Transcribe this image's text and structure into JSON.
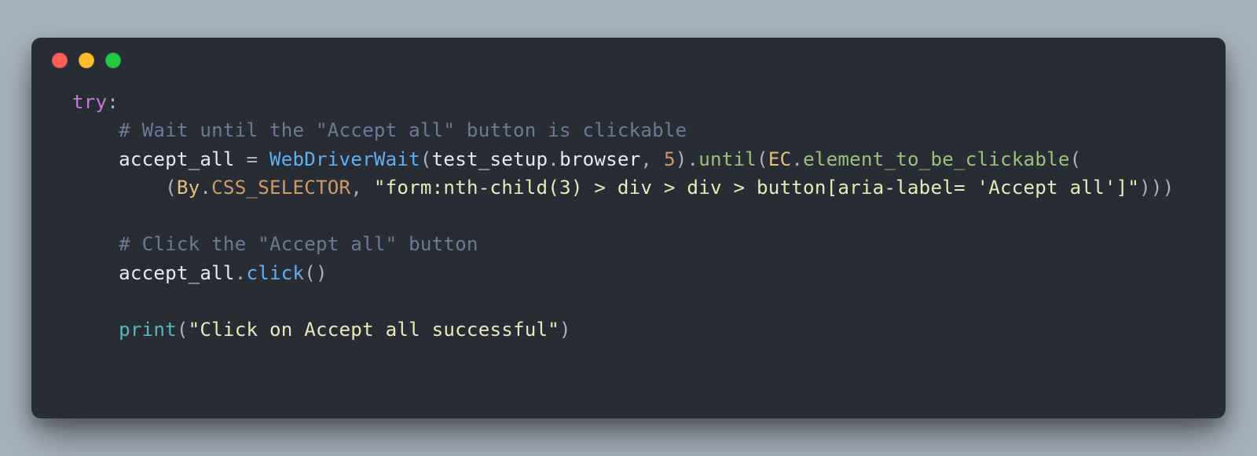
{
  "window": {
    "dots": [
      "red",
      "yellow",
      "green"
    ]
  },
  "code": {
    "tokens": [
      [
        {
          "t": "try",
          "c": "kw"
        },
        {
          "t": ":",
          "c": "op"
        }
      ],
      [
        {
          "t": "    ",
          "c": "id"
        },
        {
          "t": "# Wait until the \"Accept all\" button is clickable",
          "c": "cmt"
        }
      ],
      [
        {
          "t": "    ",
          "c": "id"
        },
        {
          "t": "accept_all",
          "c": "id"
        },
        {
          "t": " ",
          "c": "id"
        },
        {
          "t": "=",
          "c": "op"
        },
        {
          "t": " ",
          "c": "id"
        },
        {
          "t": "WebDriverWait",
          "c": "fn"
        },
        {
          "t": "(",
          "c": "op"
        },
        {
          "t": "test_setup",
          "c": "id"
        },
        {
          "t": ".",
          "c": "op"
        },
        {
          "t": "browser",
          "c": "id"
        },
        {
          "t": ",",
          "c": "op"
        },
        {
          "t": " ",
          "c": "id"
        },
        {
          "t": "5",
          "c": "num"
        },
        {
          "t": ")",
          "c": "op"
        },
        {
          "t": ".",
          "c": "op"
        },
        {
          "t": "until",
          "c": "call"
        },
        {
          "t": "(",
          "c": "op"
        },
        {
          "t": "EC",
          "c": "prop"
        },
        {
          "t": ".",
          "c": "op"
        },
        {
          "t": "element_to_be_clickable",
          "c": "call"
        },
        {
          "t": "(",
          "c": "op"
        }
      ],
      [
        {
          "t": "        ",
          "c": "id"
        },
        {
          "t": "(",
          "c": "op"
        },
        {
          "t": "By",
          "c": "prop"
        },
        {
          "t": ".",
          "c": "op"
        },
        {
          "t": "CSS_SELECTOR",
          "c": "attr"
        },
        {
          "t": ",",
          "c": "op"
        },
        {
          "t": " ",
          "c": "id"
        },
        {
          "t": "\"form:nth-child(3) > div > div > button[aria-label= 'Accept all']\"",
          "c": "str"
        },
        {
          "t": ")))",
          "c": "op"
        }
      ],
      [],
      [
        {
          "t": "    ",
          "c": "id"
        },
        {
          "t": "# Click the \"Accept all\" button",
          "c": "cmt"
        }
      ],
      [
        {
          "t": "    ",
          "c": "id"
        },
        {
          "t": "accept_all",
          "c": "id"
        },
        {
          "t": ".",
          "c": "op"
        },
        {
          "t": "click",
          "c": "fn"
        },
        {
          "t": "()",
          "c": "op"
        }
      ],
      [],
      [
        {
          "t": "    ",
          "c": "id"
        },
        {
          "t": "print",
          "c": "built"
        },
        {
          "t": "(",
          "c": "op"
        },
        {
          "t": "\"Click on Accept all successful\"",
          "c": "str"
        },
        {
          "t": ")",
          "c": "op"
        }
      ]
    ]
  }
}
